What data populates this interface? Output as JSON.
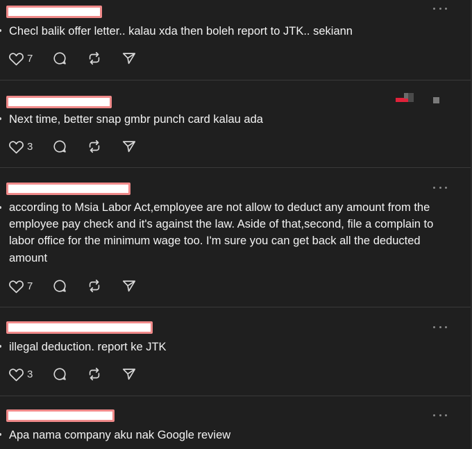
{
  "icons": [
    "like-heart-icon",
    "reply-bubble-icon",
    "repost-arrows-icon",
    "share-send-icon",
    "more-options-icon"
  ],
  "colors": {
    "background": "#1f1f1f",
    "redaction_fill": "#ffffff",
    "redaction_border": "#f08a8a",
    "text": "#f3f3f3",
    "icon": "#d8d8d8",
    "glitch_red": "#e0223a"
  },
  "comments": [
    {
      "text": "Checl balik offer letter.. kalau xda then boleh report to JTK.. sekiann",
      "likes": "7"
    },
    {
      "text": "Next time, better snap gmbr punch card kalau ada",
      "likes": "3"
    },
    {
      "text": "according to Msia Labor Act,employee are not allow to deduct any amount from the employee pay check and it's against the law. Aside of that,second, file a complain to labor office for the minimum wage too. I'm sure you can get back all the deducted amount",
      "likes": "7"
    },
    {
      "text": "illegal deduction. report ke JTK",
      "likes": "3"
    },
    {
      "text": "Apa nama company aku nak Google review"
    }
  ]
}
